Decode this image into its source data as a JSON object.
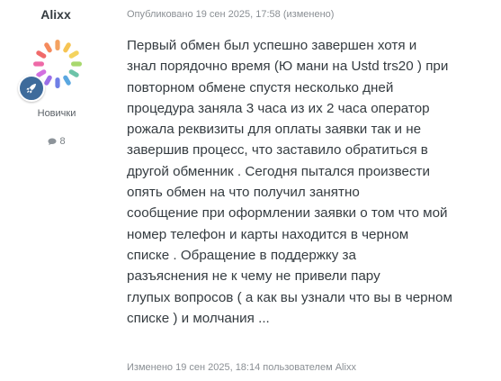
{
  "author": {
    "username": "Alixx",
    "group": "Новички",
    "post_count": "8",
    "avatar_icon": "pinwheel-avatar",
    "rank_icon": "rocket-icon",
    "rank_color": "#3e6b9b"
  },
  "post": {
    "published": "Опубликовано 19 сен 2025, 17:58 (изменено)",
    "body_lines": [
      "Первый обмен был успешно завершен хотя и",
      "знал порядочно время (Ю мани на Ustd trs20 ) при",
      "повторном обмене спустя несколько дней",
      "процедура заняла 3 часа из их 2 часа оператор",
      "рожала реквизиты для оплаты заявки так и не",
      "завершив процесс, что заставило обратиться в",
      "другой обменник . Сегодня пытался произвести",
      "опять обмен  на что получил занятно",
      "сообщение при оформлении заявки о том что мой",
      "номер  телефон и карты находится в черном",
      "списке . Обращение в поддержку за",
      "разъяснения не к чему не привели пару",
      "глупых вопросов ( а как вы узнали что вы в черном",
      "списке ) и молчания ..."
    ],
    "edited": "Изменено 19 сен 2025, 18:14 пользователем Alixx"
  }
}
